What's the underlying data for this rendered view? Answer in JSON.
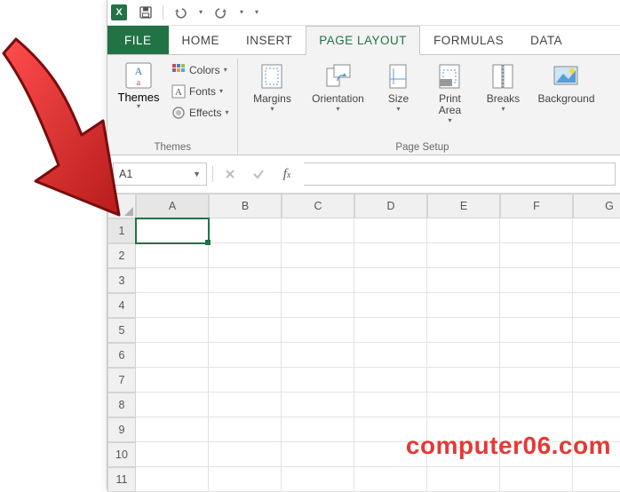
{
  "qat": {
    "save": "Save",
    "undo": "Undo",
    "redo": "Redo"
  },
  "tabs": {
    "file": "FILE",
    "home": "HOME",
    "insert": "INSERT",
    "page_layout": "PAGE LAYOUT",
    "formulas": "FORMULAS",
    "data": "DATA"
  },
  "active_tab": "page_layout",
  "ribbon": {
    "themes": {
      "label": "Themes",
      "themes_btn": "Themes",
      "colors": "Colors",
      "fonts": "Fonts",
      "effects": "Effects"
    },
    "page_setup": {
      "label": "Page Setup",
      "margins": "Margins",
      "orientation": "Orientation",
      "size": "Size",
      "print_area": "Print\nArea",
      "breaks": "Breaks",
      "background": "Background"
    }
  },
  "namebox": {
    "value": "A1"
  },
  "formula_bar": {
    "cancel_hint": "Cancel",
    "enter_hint": "Enter",
    "fx_hint": "Insert Function",
    "value": ""
  },
  "grid": {
    "columns": [
      "A",
      "B",
      "C",
      "D",
      "E",
      "F",
      "G"
    ],
    "rows": [
      "1",
      "2",
      "3",
      "4",
      "5",
      "6",
      "7",
      "8",
      "9",
      "10",
      "11"
    ],
    "active_cell": "A1"
  },
  "watermark": "computer06.com"
}
